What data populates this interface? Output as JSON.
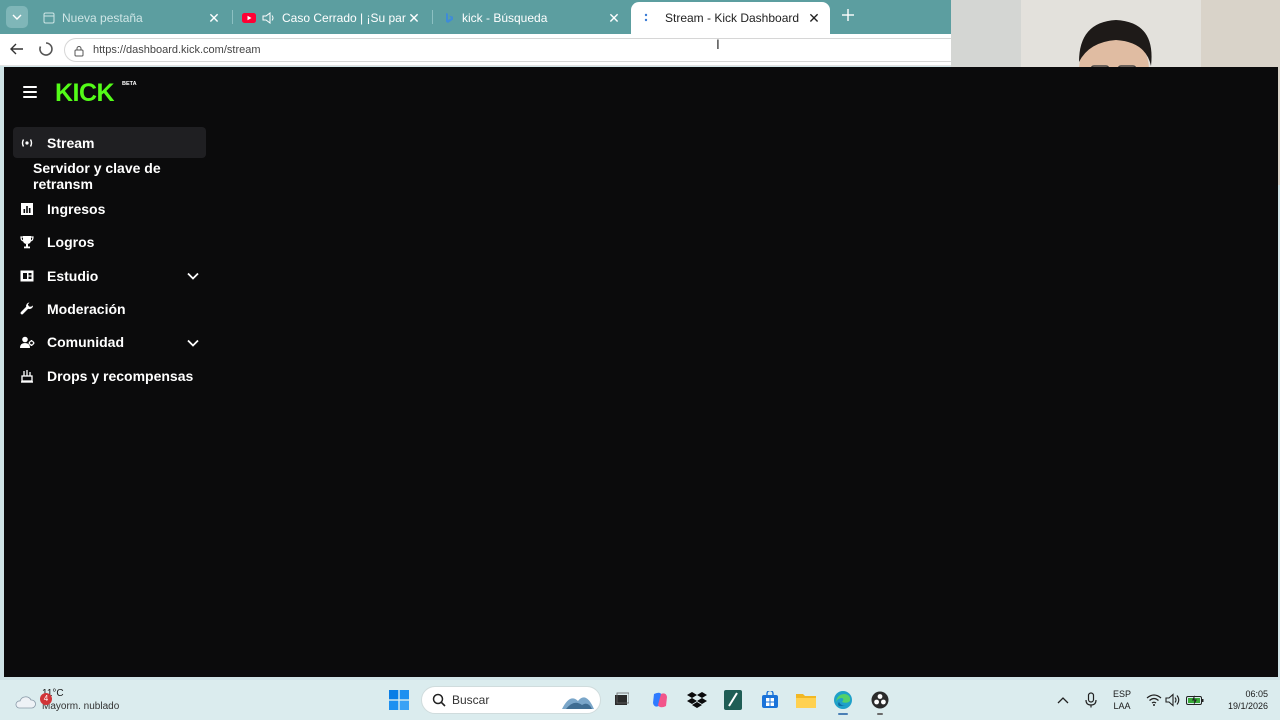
{
  "browser": {
    "tabs": [
      {
        "title": "Nueva pestaña",
        "state": "faded"
      },
      {
        "title": "Caso Cerrado | ¡Su pareja cree",
        "state": "inactive"
      },
      {
        "title": "kick - Búsqueda",
        "state": "inactive"
      },
      {
        "title": "Stream - Kick Dashboard",
        "state": "active"
      }
    ],
    "url": "https://dashboard.kick.com/stream"
  },
  "app": {
    "logo_text": "KICK",
    "logo_badge": "BETA",
    "brand_color": "#53fc18"
  },
  "sidebar": {
    "items": [
      {
        "label": "Stream",
        "icon": "broadcast-icon",
        "active": true
      },
      {
        "label": "Servidor y clave de retransm",
        "icon": "",
        "sub": true
      },
      {
        "label": "Ingresos",
        "icon": "bar-chart-icon"
      },
      {
        "label": "Logros",
        "icon": "trophy-icon"
      },
      {
        "label": "Estudio",
        "icon": "studio-icon",
        "expandable": true
      },
      {
        "label": "Moderación",
        "icon": "wrench-icon"
      },
      {
        "label": "Comunidad",
        "icon": "community-icon",
        "expandable": true
      },
      {
        "label": "Drops y recompensas",
        "icon": "gift-icon"
      }
    ]
  },
  "taskbar": {
    "weather_badge": "4",
    "weather_temp": "11°C",
    "weather_condition": "Mayorm. nublado",
    "search_placeholder": "Buscar",
    "lang_line1": "ESP",
    "lang_line2": "LAA",
    "time": "06:05",
    "date": "19/1/2026"
  }
}
